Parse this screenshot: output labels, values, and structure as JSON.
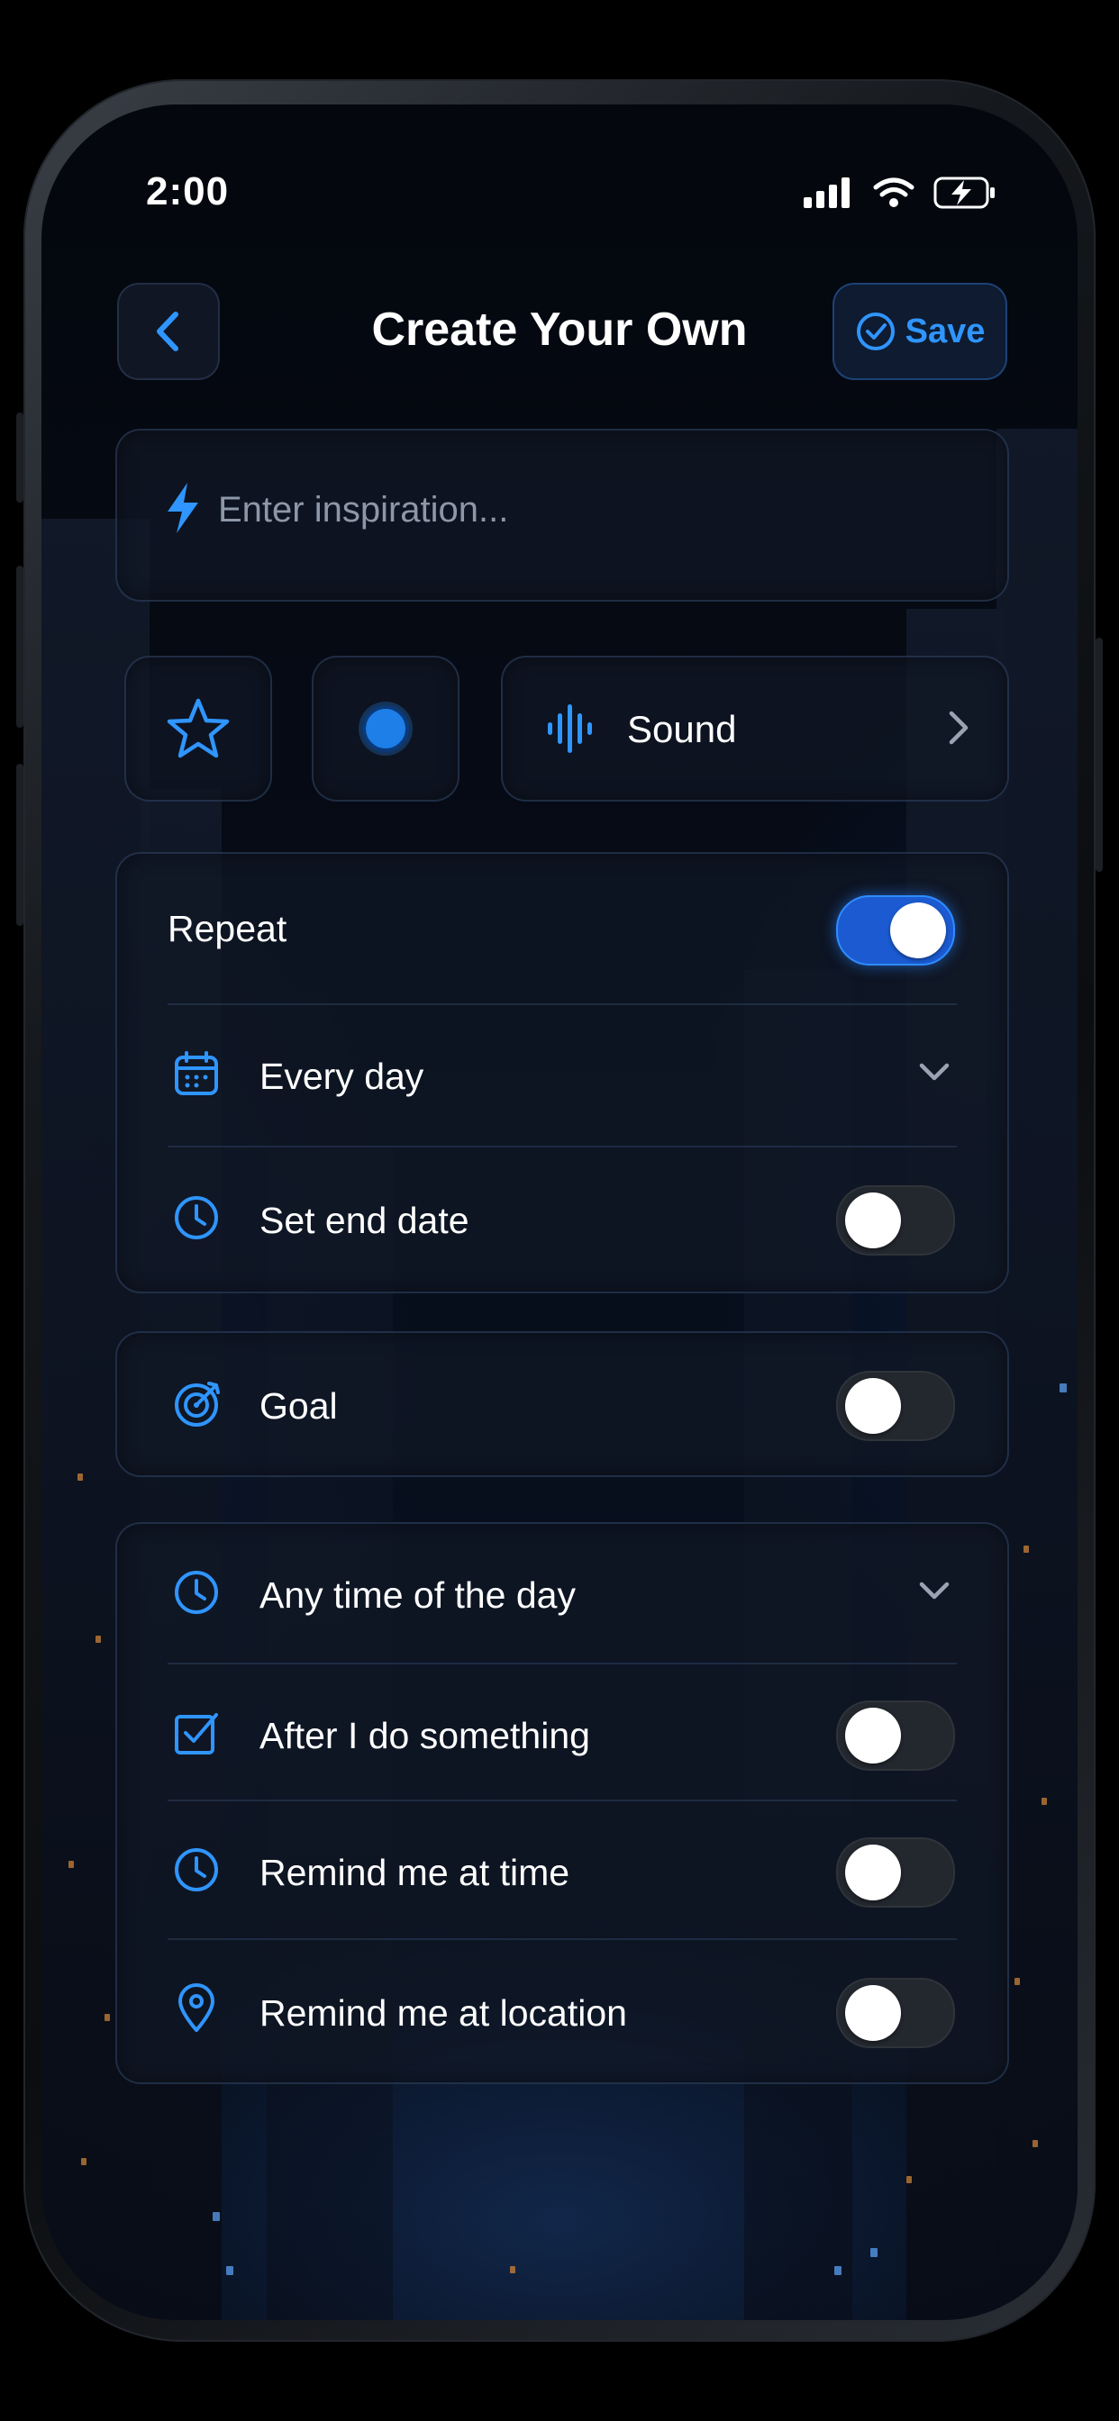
{
  "status_bar": {
    "time": "2:00"
  },
  "header": {
    "title": "Create Your Own",
    "save_label": "Save"
  },
  "inspiration_input": {
    "placeholder": "Enter inspiration..."
  },
  "quick_actions": {
    "sound_label": "Sound"
  },
  "repeat_section": {
    "repeat_label": "Repeat",
    "repeat_enabled": true,
    "frequency_label": "Every day",
    "end_date_label": "Set end date",
    "end_date_enabled": false
  },
  "goal_section": {
    "goal_label": "Goal",
    "goal_enabled": false
  },
  "reminder_section": {
    "time_of_day_label": "Any time of the day",
    "after_label": "After I do something",
    "after_enabled": false,
    "remind_time_label": "Remind me at time",
    "remind_time_enabled": false,
    "remind_location_label": "Remind me at location",
    "remind_location_enabled": false
  },
  "colors": {
    "accent": "#2F95FF",
    "background": "#050A14",
    "toggle_on": "#1B5AD1"
  },
  "icons": [
    "back-chevron-icon",
    "check-circle-icon",
    "bolt-icon",
    "star-icon",
    "color-dot-icon",
    "sound-wave-icon",
    "calendar-icon",
    "clock-icon",
    "target-icon",
    "checkbox-icon",
    "location-pin-icon",
    "chevron-down-icon",
    "chevron-right-icon"
  ]
}
